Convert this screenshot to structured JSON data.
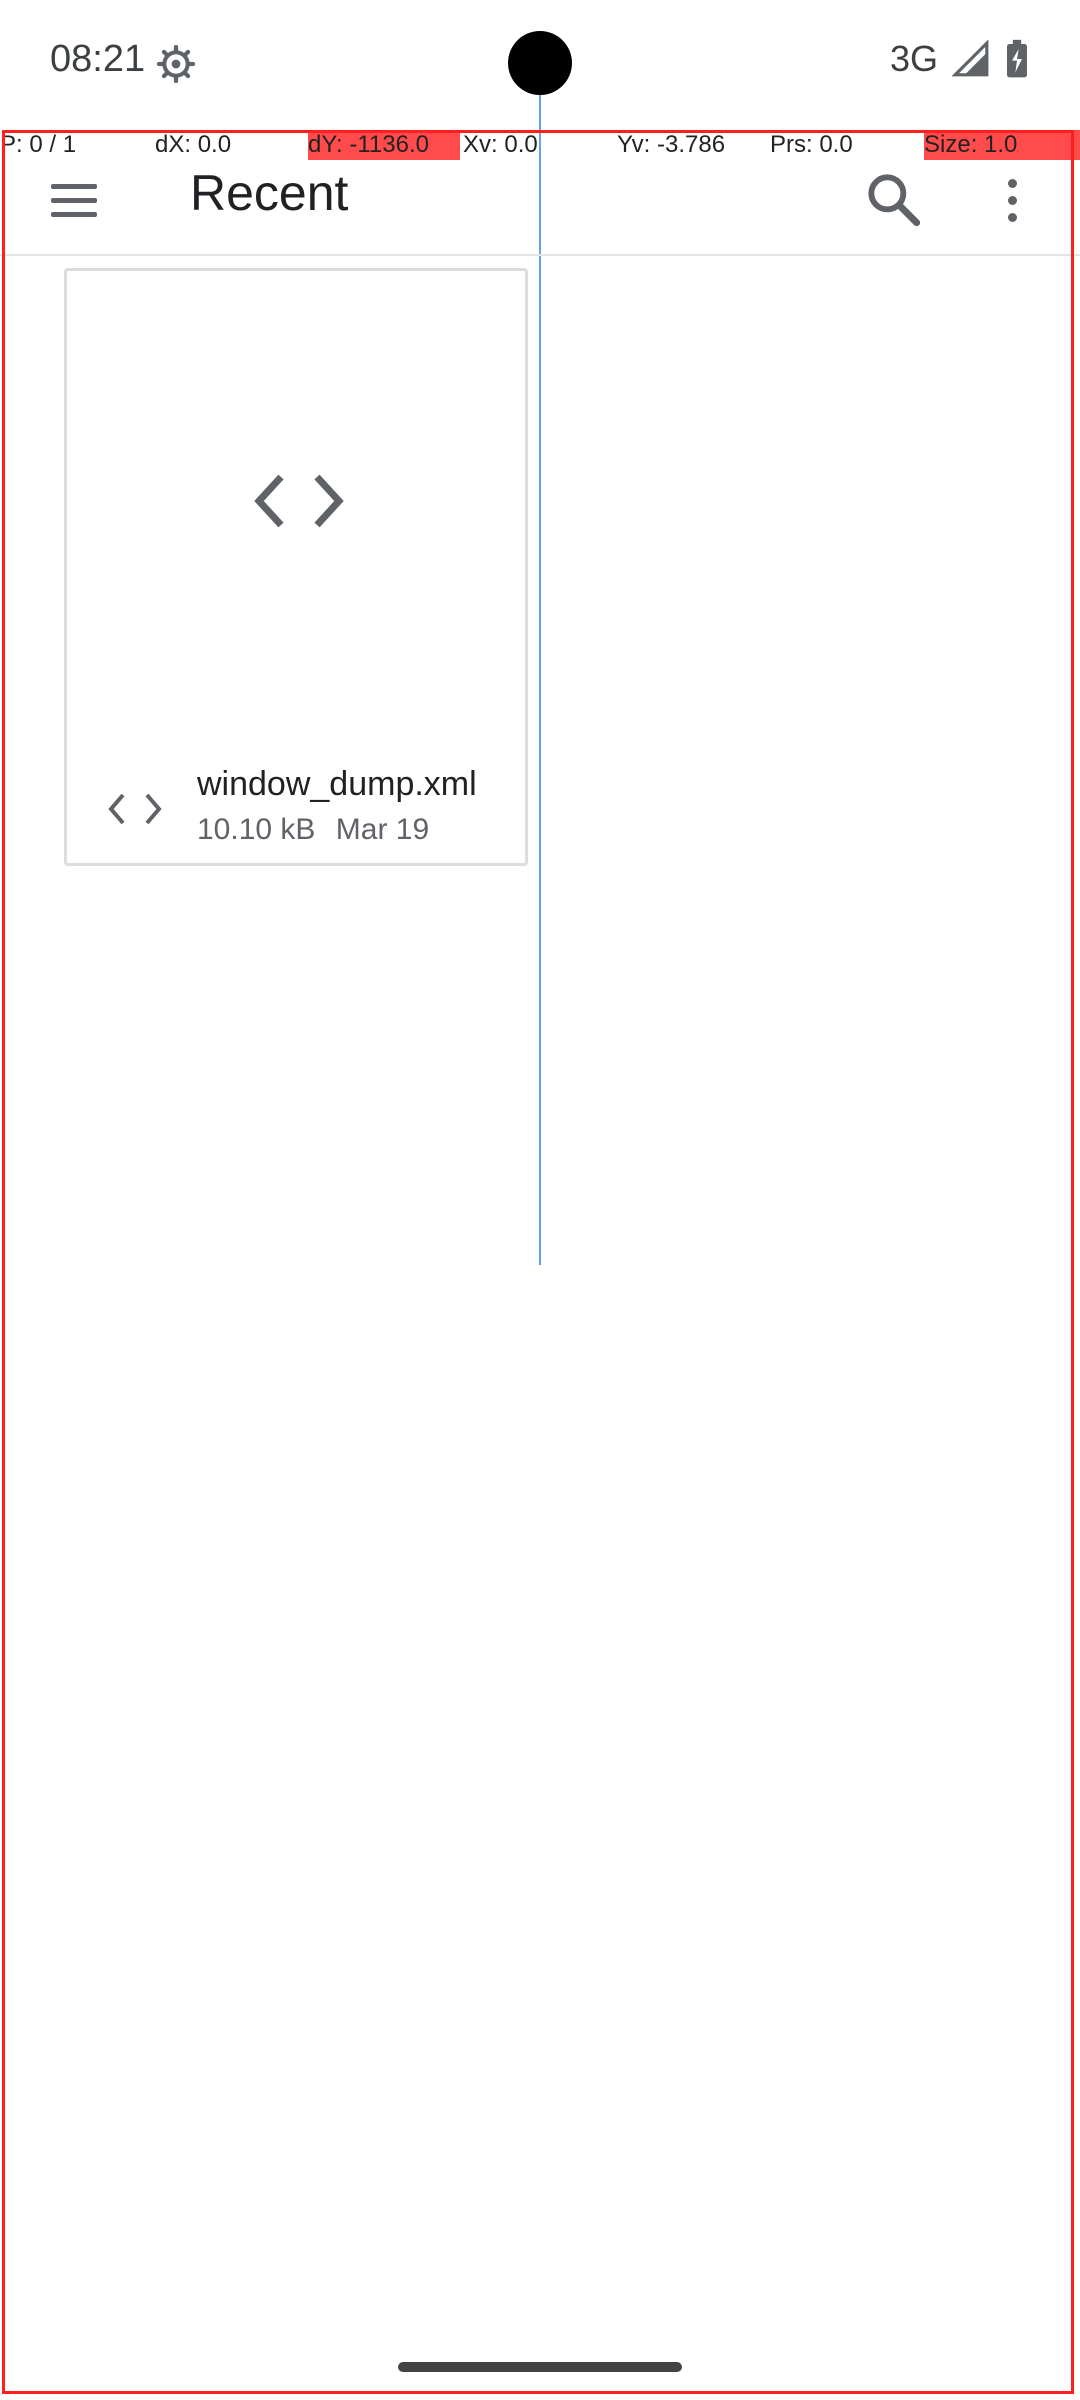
{
  "status_bar": {
    "time": "08:21",
    "network": "3G"
  },
  "pointer_overlay": {
    "pointer": "P: 0 / 1",
    "dx": "dX: 0.0",
    "dy": "dY: -1136.0",
    "xv": "Xv: 0.0",
    "yv": "Yv: -3.786",
    "prs": "Prs: 0.0",
    "size": "Size: 1.0"
  },
  "app_bar": {
    "title": "Recent"
  },
  "files": [
    {
      "name": "window_dump.xml",
      "size": "10.10 kB",
      "date": "Mar 19",
      "icon": "code-icon"
    }
  ],
  "colors": {
    "icon_gray": "#5f6368",
    "overlay_red": "#ff1f1f",
    "trace_blue": "#3d8de3"
  }
}
